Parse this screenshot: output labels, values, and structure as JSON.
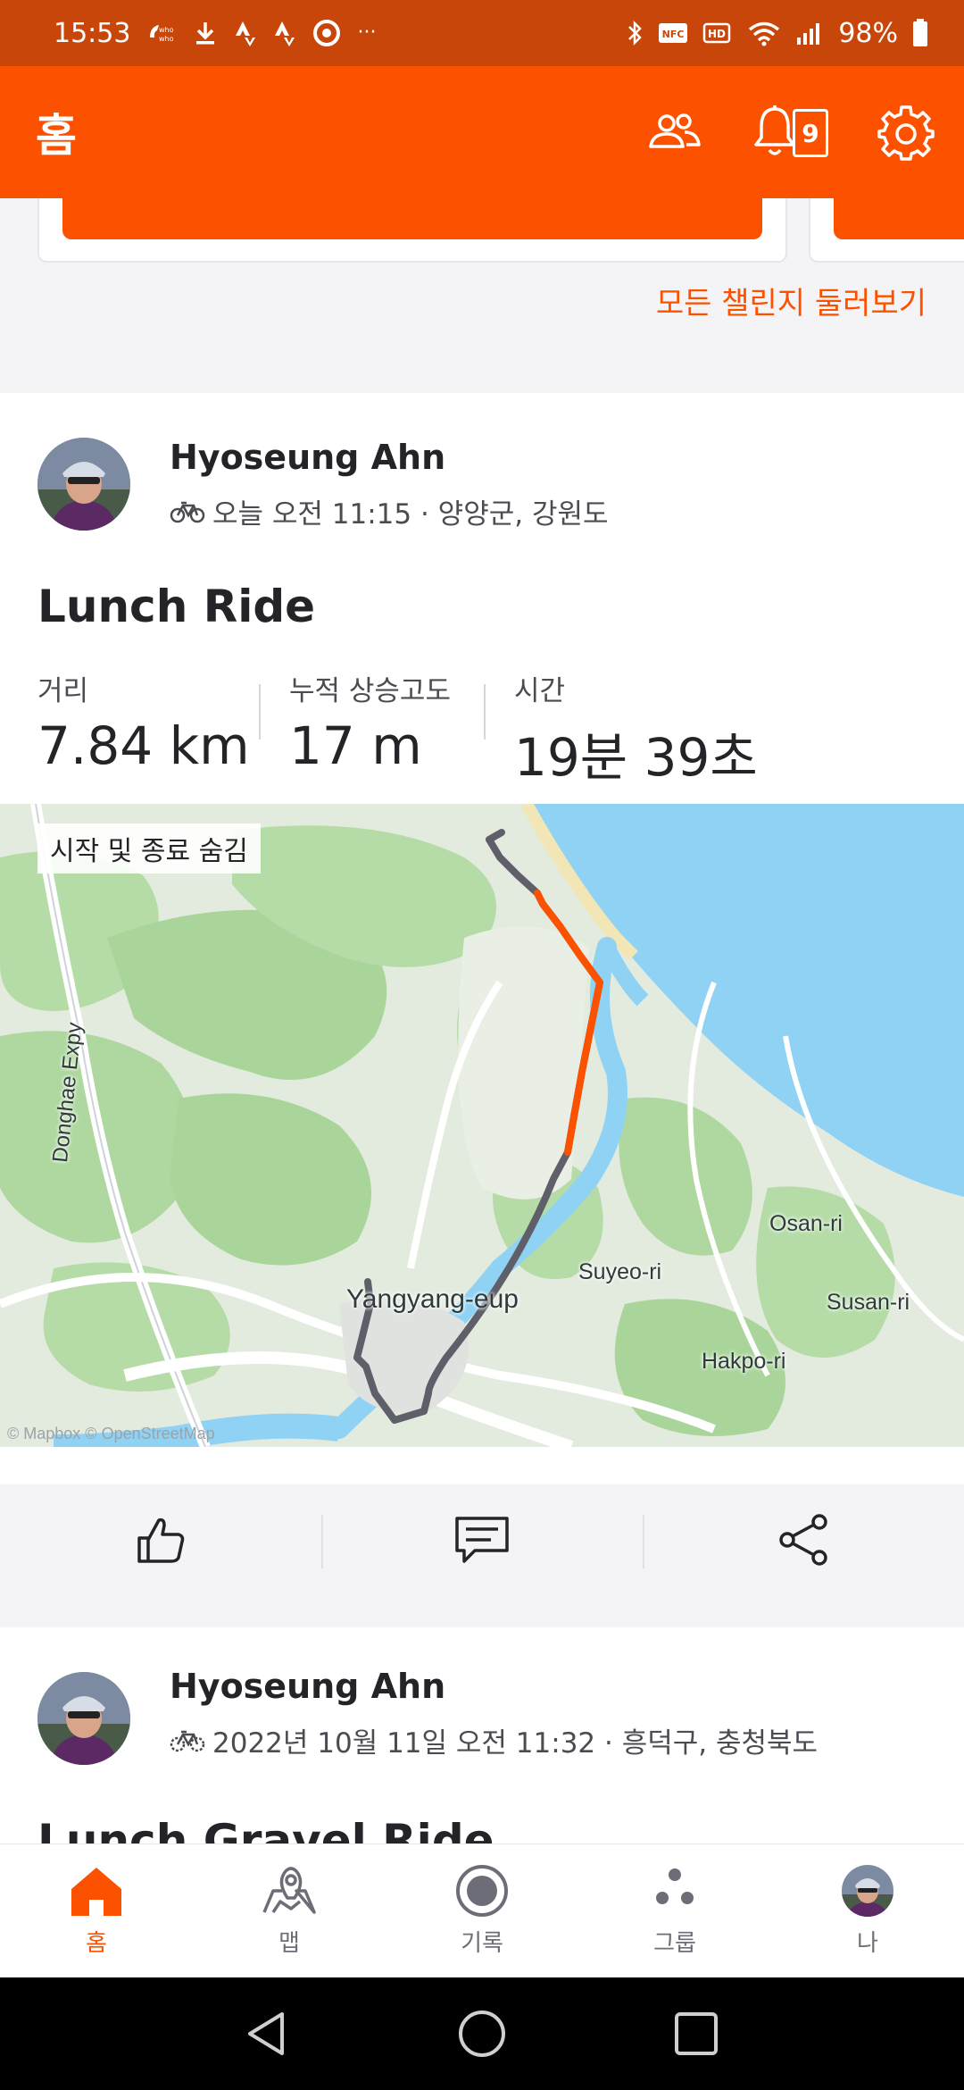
{
  "status_bar": {
    "time": "15:53",
    "battery": "98%",
    "left_icons": [
      "who-who-icon",
      "download-icon",
      "strava-icon",
      "strava-icon",
      "chrome-icon",
      "more-notifications-icon"
    ],
    "right_icons": [
      "bluetooth-icon",
      "nfc-icon",
      "hd-icon",
      "wifi-icon",
      "signal-icon",
      "battery-icon"
    ],
    "nfc_label": "NFC",
    "hd_label": "HD"
  },
  "app_bar": {
    "title": "홈",
    "notification_count": "9"
  },
  "challenges": {
    "see_all": "모든 챌린지 둘러보기"
  },
  "feed": [
    {
      "athlete": "Hyoseung Ahn",
      "meta": "오늘 오전 11:15 · 양양군, 강원도",
      "title": "Lunch Ride",
      "stats": [
        {
          "label": "거리",
          "value": "7.84 km"
        },
        {
          "label": "누적 상승고도",
          "value": "17 m"
        },
        {
          "label": "시간",
          "value": "19분 39초"
        }
      ],
      "map": {
        "toggle_label": "시작 및 종료 숨김",
        "places": {
          "expressway": "Donghae Expy",
          "town": "Yangyang-eup",
          "suyeo": "Suyeo-ri",
          "osan": "Osan-ri",
          "susan": "Susan-ri",
          "hakpo": "Hakpo-ri"
        },
        "attribution": "© Mapbox © OpenStreetMap"
      }
    },
    {
      "athlete": "Hyoseung Ahn",
      "meta": "2022년 10월 11일 오전 11:32 · 흥덕구, 충청북도",
      "title": "Lunch Gravel Ride"
    }
  ],
  "bottom_nav": [
    {
      "label": "홈",
      "icon": "home-icon",
      "active": true
    },
    {
      "label": "맵",
      "icon": "map-icon",
      "active": false
    },
    {
      "label": "기록",
      "icon": "record-icon",
      "active": false
    },
    {
      "label": "그룹",
      "icon": "groups-icon",
      "active": false
    },
    {
      "label": "나",
      "icon": "profile-avatar-icon",
      "active": false
    }
  ],
  "colors": {
    "brand": "#fc5200",
    "status_bar": "#c8460a",
    "route_gray": "#5f5f6a",
    "route_highlight": "#fc5200",
    "water": "#8fd2f4"
  }
}
